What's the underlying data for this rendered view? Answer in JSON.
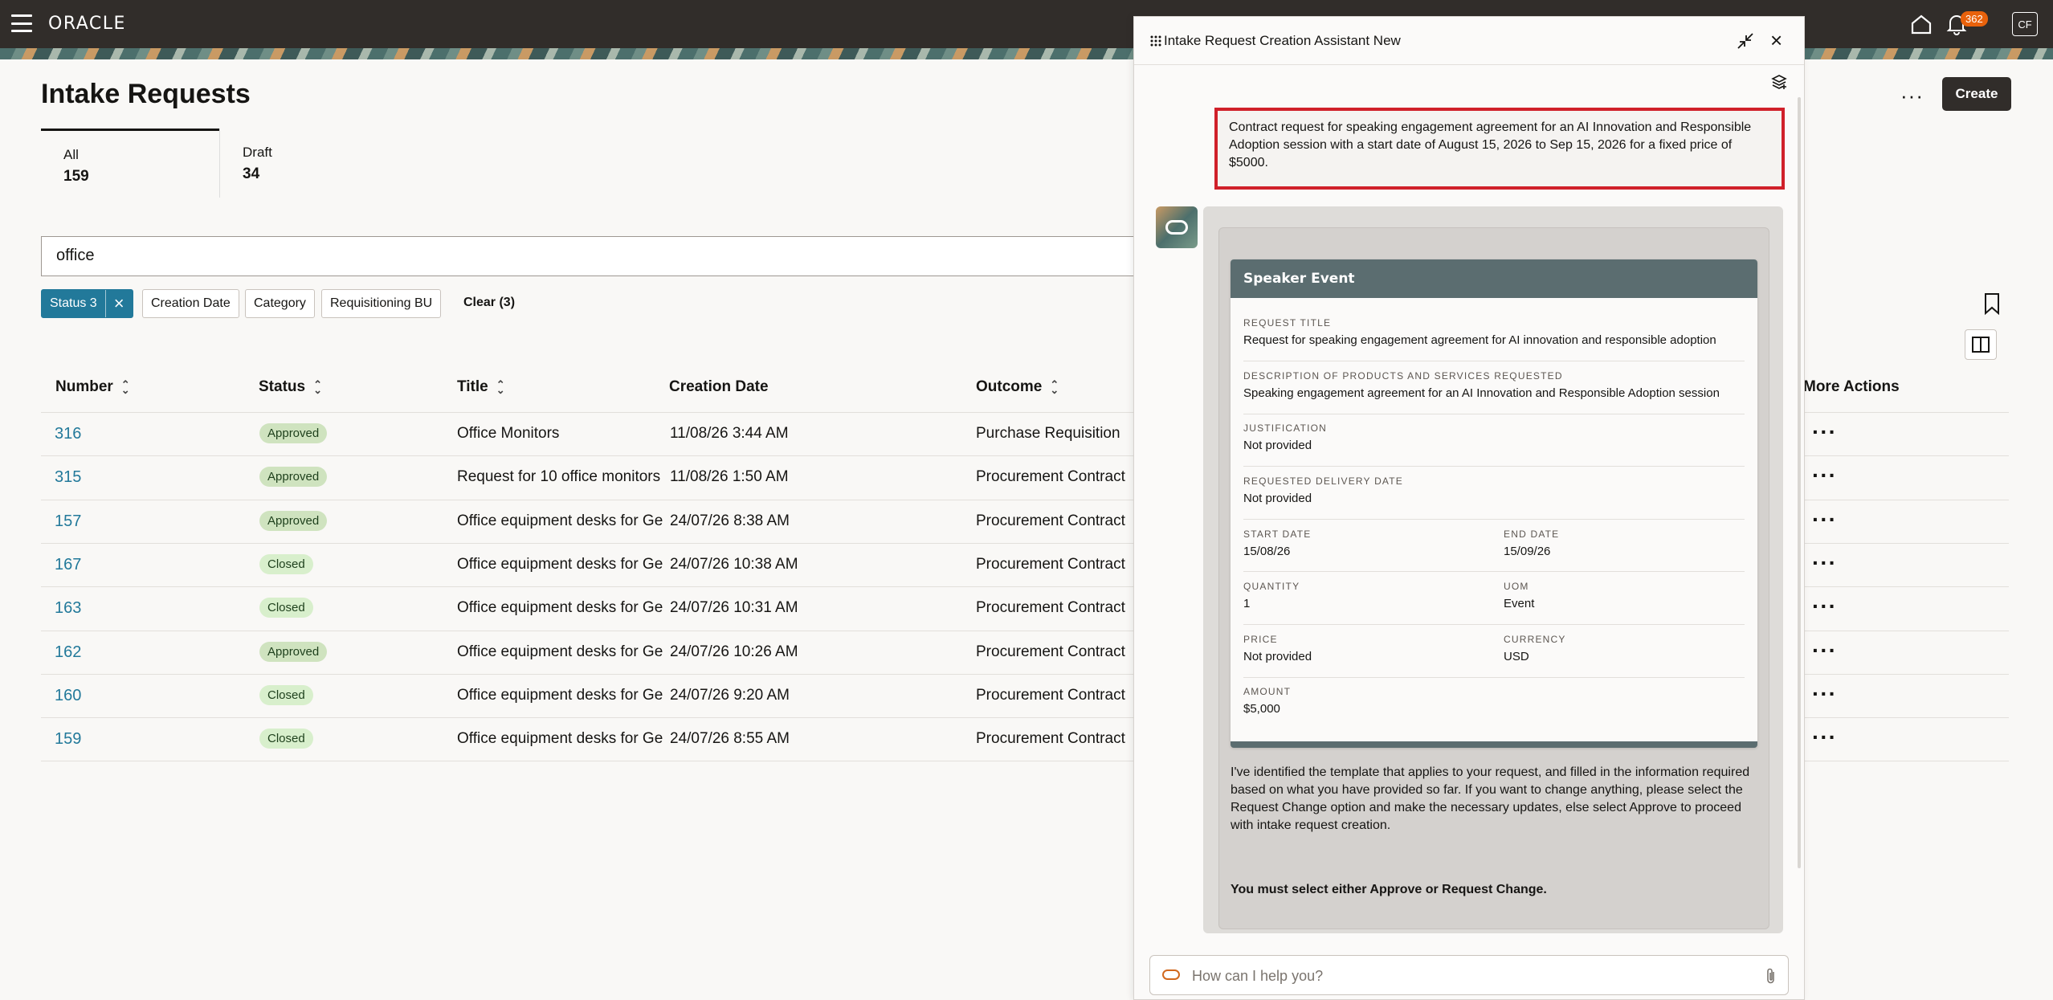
{
  "header": {
    "logo": "ORACLE",
    "notifications_count": "362",
    "avatar_initials": "CF"
  },
  "page": {
    "title": "Intake Requests",
    "more_label": "···",
    "create_label": "Create",
    "tabs": [
      {
        "label": "All",
        "count": "159"
      },
      {
        "label": "Draft",
        "count": "34"
      }
    ],
    "search_value": "office",
    "filters": {
      "status_chip": "Status 3",
      "creation_date": "Creation Date",
      "category": "Category",
      "requisitioning_bu": "Requisitioning BU",
      "clear": "Clear (3)"
    }
  },
  "table": {
    "columns": {
      "number": "Number",
      "status": "Status",
      "title": "Title",
      "creation_date": "Creation Date",
      "outcome": "Outcome",
      "more_actions": "More Actions"
    },
    "rows": [
      {
        "number": "316",
        "status": "Approved",
        "title": "Office Monitors",
        "date": "11/08/26 3:44 AM",
        "outcome": "Purchase Requisition"
      },
      {
        "number": "315",
        "status": "Approved",
        "title": "Request for 10 office monitors",
        "date": "11/08/26 1:50 AM",
        "outcome": "Procurement Contract"
      },
      {
        "number": "157",
        "status": "Approved",
        "title": "Office equipment desks for Ge",
        "date": "24/07/26 8:38 AM",
        "outcome": "Procurement Contract"
      },
      {
        "number": "167",
        "status": "Closed",
        "title": "Office equipment desks for Ge",
        "date": "24/07/26 10:38 AM",
        "outcome": "Procurement Contract"
      },
      {
        "number": "163",
        "status": "Closed",
        "title": "Office equipment desks for Ge",
        "date": "24/07/26 10:31 AM",
        "outcome": "Procurement Contract"
      },
      {
        "number": "162",
        "status": "Approved",
        "title": "Office equipment desks for Ge",
        "date": "24/07/26 10:26 AM",
        "outcome": "Procurement Contract"
      },
      {
        "number": "160",
        "status": "Closed",
        "title": "Office equipment desks for Ge",
        "date": "24/07/26 9:20 AM",
        "outcome": "Procurement Contract"
      },
      {
        "number": "159",
        "status": "Closed",
        "title": "Office equipment desks for Ge",
        "date": "24/07/26 8:55 AM",
        "outcome": "Procurement Contract"
      }
    ]
  },
  "assistant": {
    "title": "Intake Request Creation Assistant New",
    "user_message": "Contract request for speaking engagement agreement for an AI Innovation and Responsible Adoption session with a start date of August 15, 2026 to Sep 15, 2026 for a fixed price of $5000.",
    "card": {
      "heading": "Speaker Event",
      "request_title_label": "REQUEST TITLE",
      "request_title": "Request for speaking engagement agreement for AI innovation and responsible adoption",
      "description_label": "DESCRIPTION OF PRODUCTS AND SERVICES REQUESTED",
      "description": "Speaking engagement agreement for an AI Innovation and Responsible Adoption session",
      "justification_label": "JUSTIFICATION",
      "justification": "Not provided",
      "delivery_label": "REQUESTED DELIVERY DATE",
      "delivery": "Not provided",
      "start_label": "START DATE",
      "start": "15/08/26",
      "end_label": "END DATE",
      "end": "15/09/26",
      "quantity_label": "QUANTITY",
      "quantity": "1",
      "uom_label": "UOM",
      "uom": "Event",
      "price_label": "PRICE",
      "price": "Not provided",
      "currency_label": "CURRENCY",
      "currency": "USD",
      "amount_label": "AMOUNT",
      "amount": "$5,000"
    },
    "bot_message": "I've identified the template that applies to your request, and filled in the information required based on what you have provided so far. If you want to change anything, please select the Request Change option and make the necessary updates, else select Approve to proceed with intake request creation.",
    "bot_instruction": "You must select either Approve or Request Change.",
    "input_placeholder": "How can I help you?"
  },
  "colors": {
    "header_bg": "#312d2a",
    "link": "#22799a",
    "highlight_border": "#d0202a",
    "card_header": "#5b6d70",
    "approved_badge": "#cfe3bf"
  },
  "icons": [
    "hamburger-icon",
    "home-icon",
    "bell-icon",
    "bookmark-icon",
    "columns-icon",
    "sort-icon",
    "grip-icon",
    "minimize-icon",
    "close-icon",
    "layers-icon",
    "paperclip-icon"
  ]
}
